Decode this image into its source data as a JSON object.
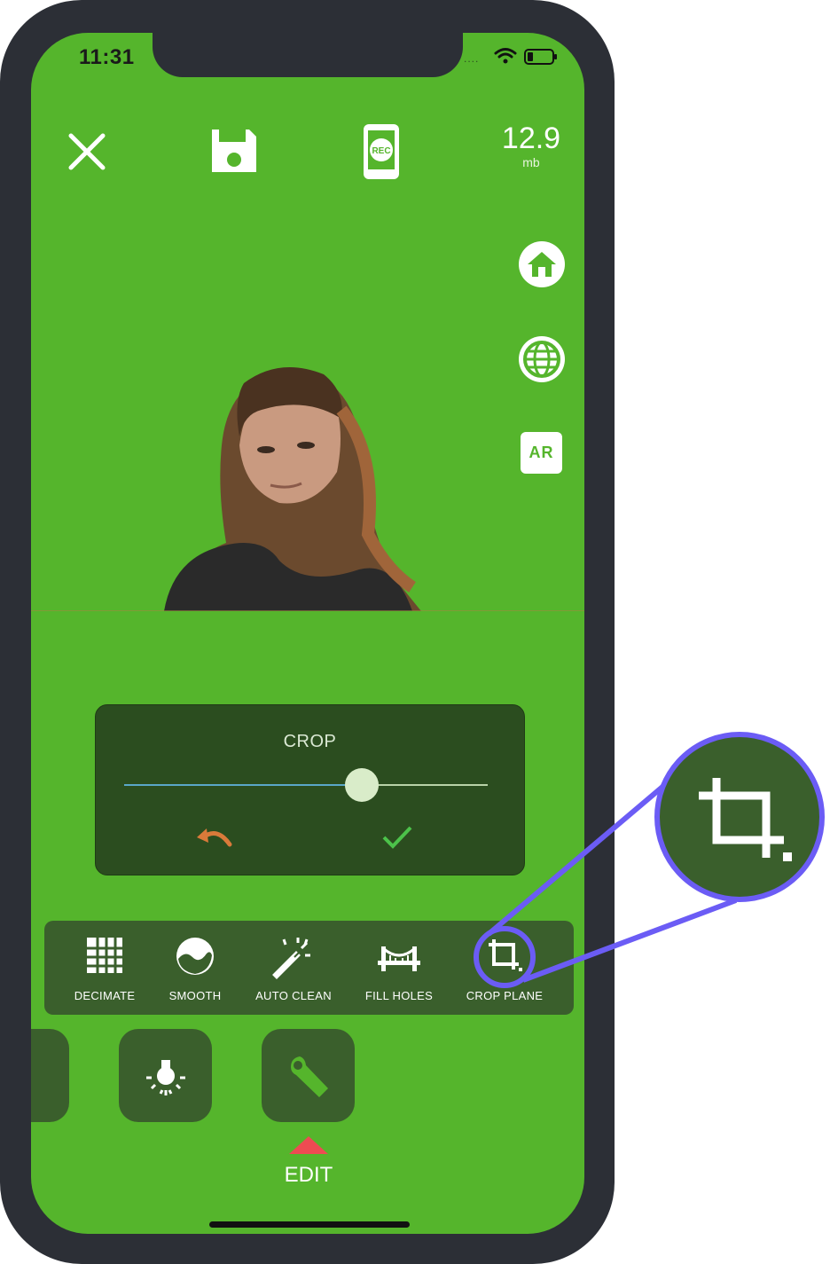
{
  "status_bar": {
    "time": "11:31",
    "signal": "....",
    "wifi_icon": "wifi-icon",
    "battery_icon": "battery-icon"
  },
  "top_bar": {
    "close_icon": "close-icon",
    "save_icon": "floppy-disk-icon",
    "record_icon": "phone-record-icon",
    "record_badge": "REC",
    "file_size_value": "12.9",
    "file_size_unit": "mb"
  },
  "side_buttons": [
    {
      "icon": "home-icon"
    },
    {
      "icon": "globe-icon"
    },
    {
      "icon": "ar-icon",
      "label": "AR"
    }
  ],
  "crop_panel": {
    "title": "CROP",
    "slider_value_fraction": 0.65,
    "undo_icon": "undo-icon",
    "confirm_icon": "checkmark-icon",
    "colors": {
      "track_active": "#5aa7c9",
      "undo": "#d97a3a",
      "confirm": "#4cc24a"
    }
  },
  "tools": [
    {
      "label": "DECIMATE",
      "icon": "grid-icon"
    },
    {
      "label": "SMOOTH",
      "icon": "wave-icon"
    },
    {
      "label": "AUTO CLEAN",
      "icon": "magic-wand-icon"
    },
    {
      "label": "FILL HOLES",
      "icon": "bridge-icon"
    },
    {
      "label": "CROP PLANE",
      "icon": "crop-icon",
      "highlighted": true
    }
  ],
  "mode_bar": {
    "modes": [
      {
        "icon": "light-bulb-icon"
      },
      {
        "icon": "wrench-icon",
        "selected": true
      }
    ],
    "active_label": "EDIT"
  },
  "colors": {
    "background": "#55b52c",
    "panel": "#3a5f2c",
    "callout": "#6b5cf5",
    "active_indicator": "#ee4b52"
  }
}
